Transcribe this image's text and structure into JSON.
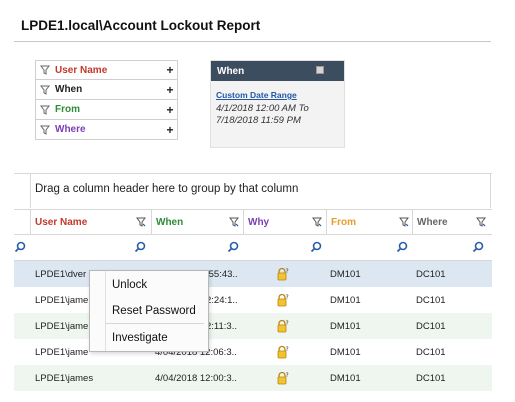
{
  "report": {
    "title": "LPDE1.local\\Account Lockout Report"
  },
  "filters": [
    {
      "label": "User Name",
      "color": "#c0392b",
      "add": "+"
    },
    {
      "label": "When",
      "color": "#222222",
      "add": "+"
    },
    {
      "label": "From",
      "color": "#2e8b3a",
      "add": "+"
    },
    {
      "label": "Where",
      "color": "#7b3fb3",
      "add": "+"
    }
  ],
  "when_panel": {
    "title": "When",
    "link": "Custom Date Range",
    "range_line1": "4/1/2018 12:00 AM To",
    "range_line2": "7/18/2018 11:59 PM"
  },
  "grid": {
    "group_hint": "Drag a column header here to group by that column",
    "columns": [
      {
        "label": "User Name",
        "color": "#c0392b"
      },
      {
        "label": "When",
        "color": "#2e8b3a"
      },
      {
        "label": "Why",
        "color": "#7b3fb3"
      },
      {
        "label": "From",
        "color": "#e69c2e"
      },
      {
        "label": "Where",
        "color": "#666666"
      }
    ],
    "rows": [
      {
        "user": "LPDE1\\dver",
        "when": ":55:43..",
        "from": "DM101",
        "where": "DC101"
      },
      {
        "user": "LPDE1\\jame",
        "when": "2:24:1..",
        "from": "DM101",
        "where": "DC101"
      },
      {
        "user": "LPDE1\\jame",
        "when": "2:11:3..",
        "from": "DM101",
        "where": "DC101"
      },
      {
        "user": "LPDE1\\jame",
        "when": "4/04/2018 12:06:3..",
        "from": "DM101",
        "where": "DC101"
      },
      {
        "user": "LPDE1\\james",
        "when": "4/04/2018 12:00:3..",
        "from": "DM101",
        "where": "DC101"
      }
    ]
  },
  "context_menu": {
    "items": [
      "Unlock",
      "Reset Password",
      "Investigate"
    ]
  },
  "icons": {
    "filter": "funnel-icon",
    "search": "search-icon",
    "lock": "lock-icon",
    "close": "close-icon"
  }
}
